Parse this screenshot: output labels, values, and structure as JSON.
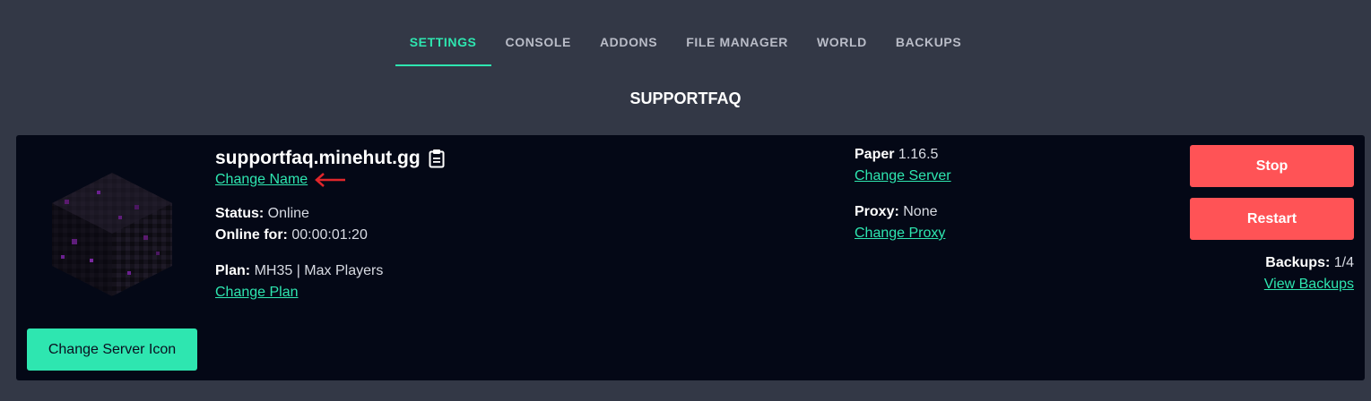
{
  "tabs": [
    {
      "label": "SETTINGS",
      "active": true
    },
    {
      "label": "CONSOLE",
      "active": false
    },
    {
      "label": "ADDONS",
      "active": false
    },
    {
      "label": "FILE MANAGER",
      "active": false
    },
    {
      "label": "WORLD",
      "active": false
    },
    {
      "label": "BACKUPS",
      "active": false
    }
  ],
  "page_title": "SUPPORTFAQ",
  "server": {
    "address": "supportfaq.minehut.gg",
    "copy_icon": "clipboard-icon",
    "change_name": "Change Name",
    "status_label": "Status:",
    "status_value": "Online",
    "online_for_label": "Online for:",
    "online_for_value": "00:00:01:20",
    "plan_label": "Plan:",
    "plan_value": "MH35 | Max Players",
    "change_plan": "Change Plan",
    "change_icon_button": "Change Server Icon"
  },
  "software": {
    "type_label": "Paper",
    "version": "1.16.5",
    "change_server": "Change Server",
    "proxy_label": "Proxy:",
    "proxy_value": "None",
    "change_proxy": "Change Proxy"
  },
  "actions": {
    "stop": "Stop",
    "restart": "Restart",
    "backups_label": "Backups:",
    "backups_value": "1/4",
    "view_backups": "View Backups"
  },
  "colors": {
    "background": "#333846",
    "panel": "#040816",
    "accent": "#2ee6b0",
    "danger": "#ff5356",
    "annotation_arrow": "#e0262b"
  }
}
